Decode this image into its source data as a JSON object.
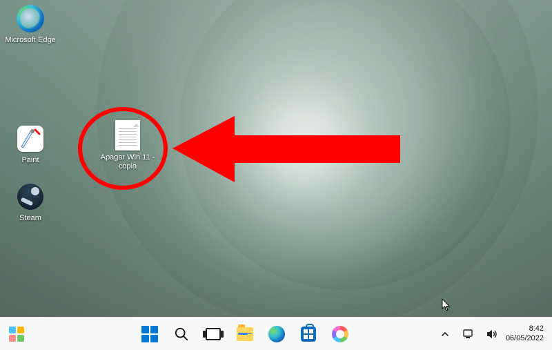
{
  "desktop": {
    "icons": {
      "edge": {
        "label": "Microsoft Edge"
      },
      "paint": {
        "label": "Paint"
      },
      "steam": {
        "label": "Steam"
      },
      "shortcut_file": {
        "label": "Apagar Win 11 - copia"
      }
    }
  },
  "taskbar": {
    "pinned": {
      "widgets": "Widgets",
      "start": "Start",
      "search": "Search",
      "taskview": "Task View",
      "explorer": "File Explorer",
      "edge": "Microsoft Edge",
      "store": "Microsoft Store",
      "paint": "Paint"
    },
    "systray": {
      "chevron": "Show hidden icons",
      "network": "Network",
      "volume": "Volume"
    },
    "clock": {
      "time": "8:42",
      "date": "06/05/2022"
    }
  },
  "annotation": {
    "target": "shortcut_file",
    "shape": "circle",
    "arrow_direction": "left",
    "color": "#ff0000"
  }
}
